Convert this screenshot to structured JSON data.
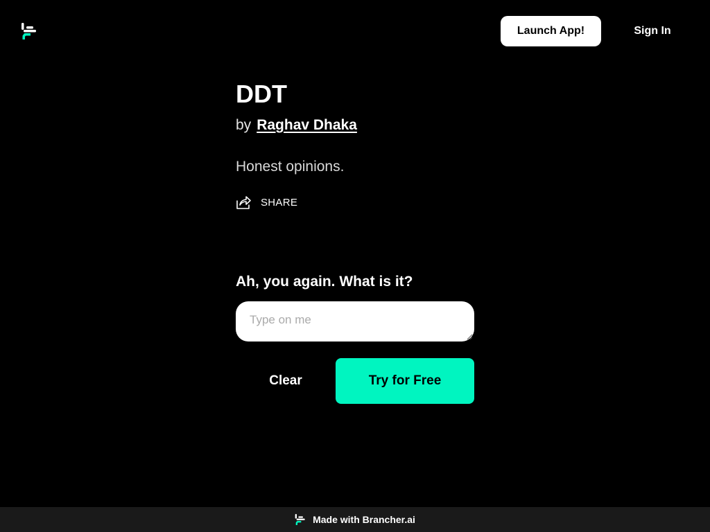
{
  "header": {
    "logo_icon": "brancher-logo-icon",
    "launch_label": "Launch App!",
    "signin_label": "Sign In"
  },
  "bot": {
    "title": "DDT",
    "by_word": "by",
    "author": "Raghav Dhaka",
    "description": "Honest opinions.",
    "share_icon": "share-icon",
    "share_label": "SHARE"
  },
  "chat": {
    "prompt": "Ah, you again. What is it?",
    "input_value": "",
    "input_placeholder": "Type on me",
    "clear_label": "Clear",
    "submit_label": "Try for Free"
  },
  "footer": {
    "logo_icon": "brancher-logo-icon",
    "text": "Made with Brancher.ai"
  },
  "colors": {
    "background": "#000000",
    "accent": "#00f5c0",
    "footer_bg": "#1a1a1a",
    "button_light": "#ffffff"
  }
}
